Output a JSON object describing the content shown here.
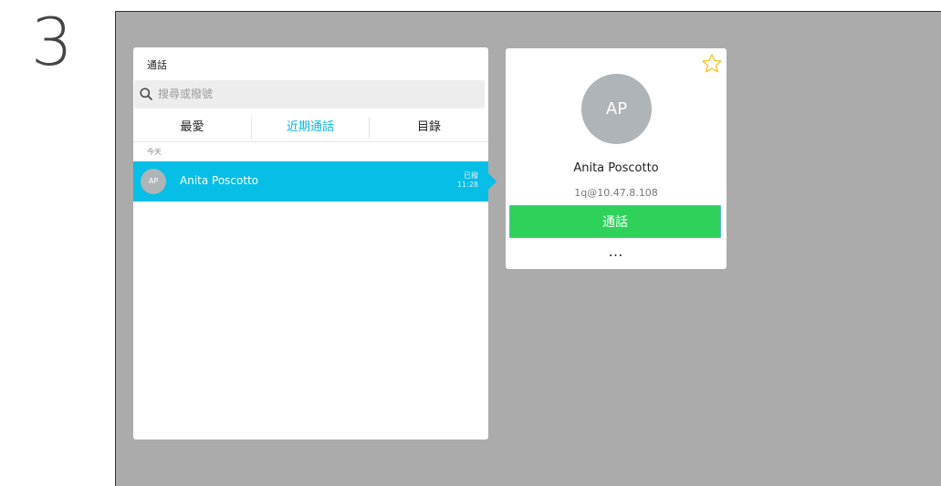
{
  "step": {
    "number": "3"
  },
  "panel": {
    "title": "通話",
    "search": {
      "placeholder": "搜尋或撥號",
      "value": ""
    },
    "tabs": [
      {
        "label": "最愛",
        "active": false
      },
      {
        "label": "近期通話",
        "active": true
      },
      {
        "label": "目錄",
        "active": false
      }
    ],
    "section_label": "今天",
    "entries": [
      {
        "initials": "AP",
        "name": "Anita Poscotto",
        "status": "已撥",
        "time": "11:28",
        "selected": true
      }
    ]
  },
  "contact_card": {
    "initials": "AP",
    "name": "Anita Poscotto",
    "address": "1q@10.47.8.108",
    "call_label": "通話",
    "more_label": "…",
    "favorite_icon": "star-outline-icon"
  },
  "colors": {
    "accent": "#07bee6",
    "active_tab": "#07b8e4",
    "call_button": "#2ed25a",
    "star": "#f2c21b",
    "screen_background": "#ababab"
  }
}
